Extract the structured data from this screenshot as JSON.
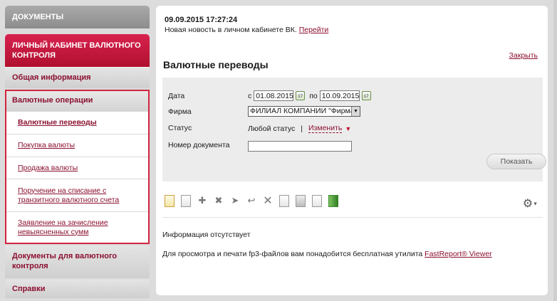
{
  "sidebar": {
    "docs": "ДОКУМЕНТЫ",
    "cabinet": "ЛИЧНЫЙ КАБИНЕТ ВАЛЮТНОГО КОНТРОЛЯ",
    "general": "Общая информация",
    "ops_group": "Валютные операции",
    "ops_items": [
      "Валютные переводы",
      "Покупка валюты",
      "Продажа валюты",
      "Поручение на списание с транзитного валютного счета",
      "Заявление на зачисление невыясненных сумм"
    ],
    "control_docs": "Документы для валютного контроля",
    "refs": "Справки"
  },
  "news": {
    "date": "09.09.2015 17:27:24",
    "text": "Новая новость в личном кабинете ВК.",
    "link": "Перейти"
  },
  "close_label": "Закрыть",
  "page_title": "Валютные переводы",
  "filter": {
    "date_label": "Дата",
    "from_label": "с",
    "from_value": "01.08.2015",
    "to_label": "по",
    "to_value": "10.09.2015",
    "firm_label": "Фирма",
    "firm_value": "ФИЛИАЛ КОМПАНИИ \"Фирма",
    "status_label": "Статус",
    "status_value": "Любой статус",
    "status_sep": "|",
    "change_label": "Изменить",
    "docnum_label": "Номер документа",
    "docnum_value": "",
    "show_label": "Показать"
  },
  "toolbar_icons": [
    "new-doc-icon",
    "edit-doc-icon",
    "sign-icon",
    "unsign-icon",
    "send-icon",
    "receive-icon",
    "delete-icon",
    "copy-icon",
    "print-icon",
    "export-icon",
    "archive-icon"
  ],
  "info_empty": "Информация отсутствует",
  "info_note": "Для просмотра и печати fp3-файлов вам понадобится бесплатная утилита",
  "info_link": "FastReport® Viewer"
}
